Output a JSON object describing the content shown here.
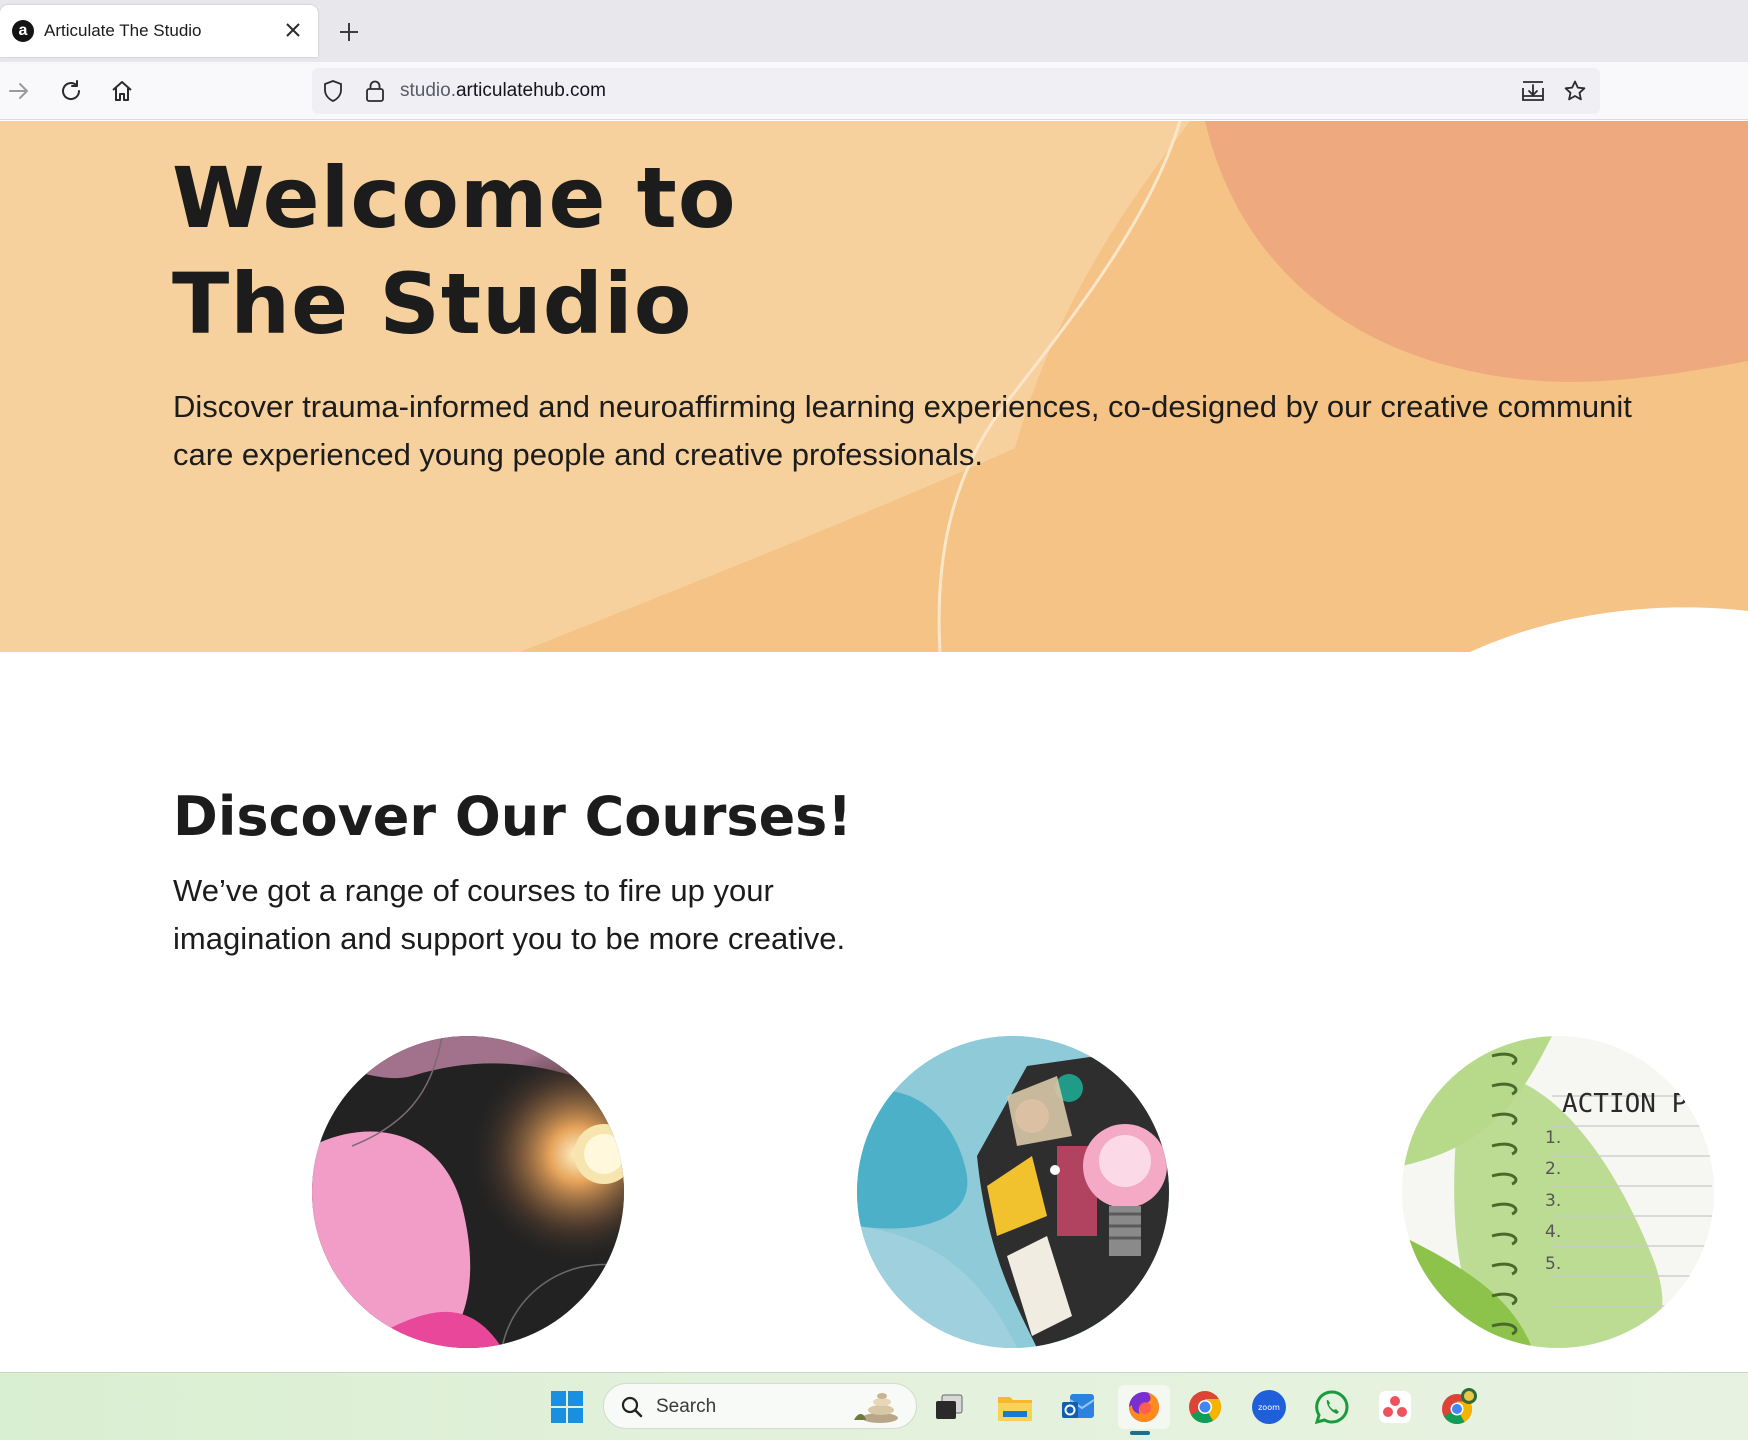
{
  "browser": {
    "tab": {
      "title": "Articulate The Studio",
      "favicon_letter": "a"
    },
    "address": {
      "subdomain": "studio.",
      "domain": "articulatehub.com"
    },
    "icons": [
      "forward-icon",
      "reload-icon",
      "home-icon",
      "shield-icon",
      "lock-icon",
      "download-icon",
      "bookmark-star-icon"
    ]
  },
  "hero": {
    "title_line1": "Welcome to",
    "title_line2": "The Studio",
    "description_line1": "Discover trauma-informed and neuroaffirming learning experiences, co-designed by our creative communit",
    "description_line2": "care experienced young people and creative professionals.",
    "colors": {
      "base": "#f4c385",
      "light": "#f6d4a2",
      "blob": "#eeaa7e"
    }
  },
  "courses": {
    "title": "Discover Our Courses!",
    "description_line1": "We’ve got a range of courses to fire up your",
    "description_line2": "imagination and support you to be more creative.",
    "cards": [
      {
        "theme": "pink spotlight"
      },
      {
        "theme": "blue collage lightbulb"
      },
      {
        "theme": "green notebook",
        "notebook_title": "ACTION P.",
        "list_numbers": [
          "1.",
          "2.",
          "3.",
          "4.",
          "5."
        ]
      }
    ]
  },
  "taskbar": {
    "search_placeholder": "Search",
    "zoom_label": "zoom",
    "icons": [
      "windows-start-icon",
      "search-icon",
      "task-view-icon",
      "file-explorer-icon",
      "outlook-icon",
      "firefox-icon",
      "chrome-icon",
      "zoom-icon",
      "whatsapp-icon",
      "asana-icon",
      "chrome-canary-icon"
    ]
  }
}
